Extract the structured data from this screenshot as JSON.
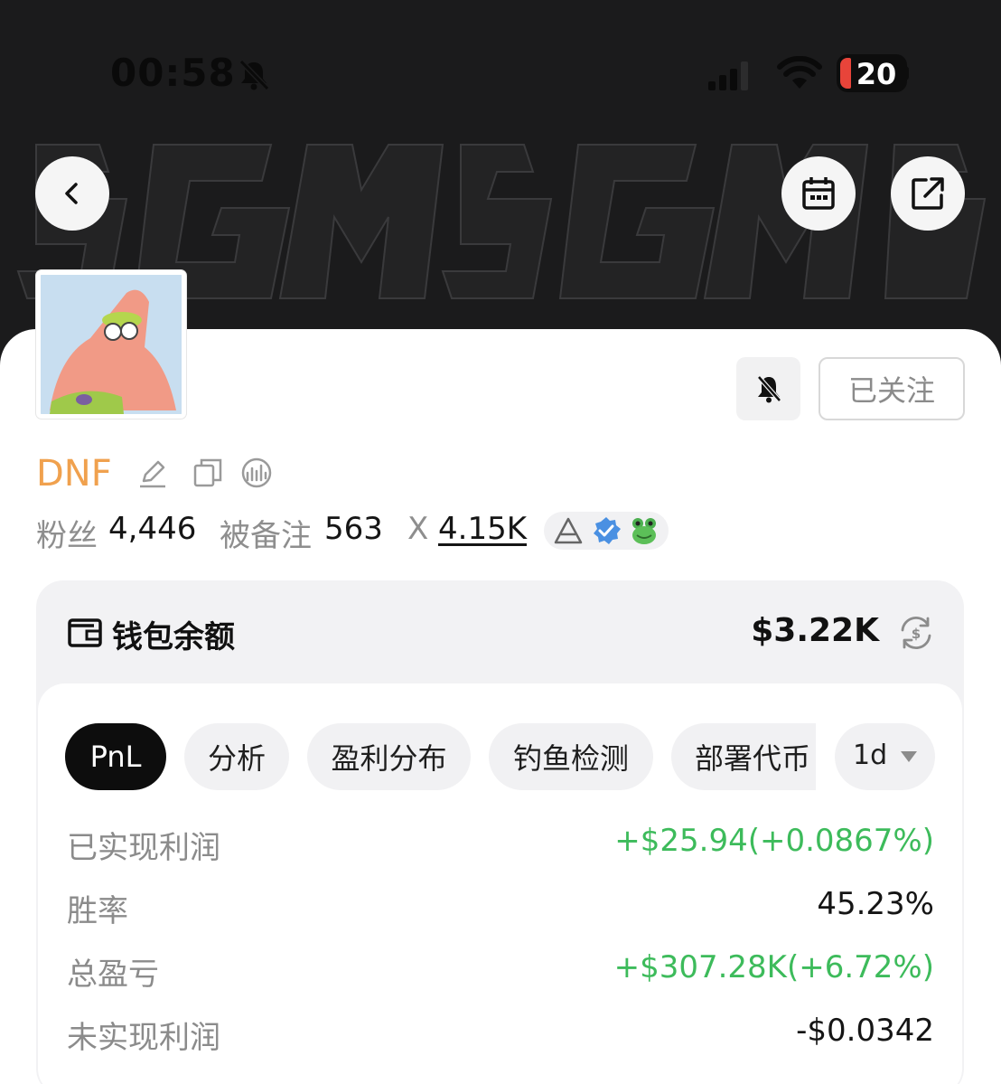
{
  "status_bar": {
    "time": "00:58",
    "battery": "20"
  },
  "profile": {
    "name": "DNF",
    "follow_label": "已关注",
    "stats": {
      "followers_label": "粉丝",
      "followers_value": "4,446",
      "noted_label": "被备注",
      "noted_value": "563",
      "x_label": "X",
      "x_value": "4.15K"
    }
  },
  "wallet": {
    "title": "钱包余额",
    "amount": "$3.22K",
    "tabs": [
      "PnL",
      "分析",
      "盈利分布",
      "钓鱼检测",
      "部署代币"
    ],
    "active_tab": "PnL",
    "period": "1d",
    "rows": [
      {
        "label": "已实现利润",
        "value": "+$25.94(+0.0867%)",
        "tone": "positive"
      },
      {
        "label": "胜率",
        "value": "45.23%",
        "tone": "neutral"
      },
      {
        "label": "总盈亏",
        "value": "+$307.28K(+6.72%)",
        "tone": "positive"
      },
      {
        "label": "未实现利润",
        "value": "-$0.0342",
        "tone": "neutral"
      }
    ]
  },
  "colors": {
    "banner": "#1b1b1c",
    "name": "#f0a14e",
    "positive": "#3dbb5b",
    "active_tab": "#0d0d0d",
    "card": "#f2f2f4"
  },
  "icons": {
    "back": "chevron-left-icon",
    "calendar": "calendar-icon",
    "share": "share-icon",
    "mute": "bell-slash-icon",
    "edit": "pencil-icon",
    "copy": "copy-icon",
    "explorer": "chart-link-icon",
    "wallet": "wallet-icon",
    "currency": "currency-swap-icon",
    "period": "caret-down-icon"
  }
}
